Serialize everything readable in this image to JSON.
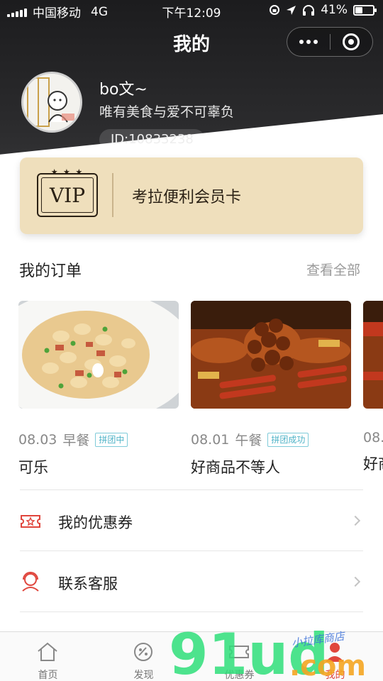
{
  "status_bar": {
    "carrier": "中国移动",
    "network": "4G",
    "time": "下午12:09",
    "battery": "41%",
    "battery_level": 0.41
  },
  "nav": {
    "title": "我的"
  },
  "profile": {
    "name": "bo文~",
    "motto": "唯有美食与爱不可辜负",
    "id": "ID:10833238"
  },
  "vip_card": {
    "badge": "VIP",
    "title": "考拉便利会员卡"
  },
  "orders": {
    "title": "我的订单",
    "view_all": "查看全部",
    "items": [
      {
        "date": "08.03",
        "meal": "早餐",
        "tag": "拼团中",
        "name": "可乐"
      },
      {
        "date": "08.01",
        "meal": "午餐",
        "tag": "拼团成功",
        "name": "好商品不等人"
      },
      {
        "date": "08.",
        "meal": "",
        "tag": "",
        "name": "好商"
      }
    ]
  },
  "menu": [
    {
      "label": "我的优惠券",
      "icon": "ticket-icon"
    },
    {
      "label": "联系客服",
      "icon": "customer-service-icon"
    }
  ],
  "tabbar": {
    "tabs": [
      {
        "label": "首页",
        "icon": "home-icon",
        "active": false
      },
      {
        "label": "发现",
        "icon": "discover-icon",
        "active": false
      },
      {
        "label": "优惠券",
        "icon": "coupon-icon",
        "active": false
      },
      {
        "label": "我的",
        "icon": "profile-icon",
        "active": true
      }
    ]
  },
  "watermark": {
    "logo": "91ud",
    "domain": ".com",
    "script": "小拉库商店"
  },
  "colors": {
    "header_dark": "#1c1c1e",
    "vip_gold": "#efdfbc",
    "accent_red": "#e0463d",
    "tag_teal": "#4fb3c7",
    "watermark_green": "#2fe07a",
    "watermark_orange": "#f5a623"
  }
}
